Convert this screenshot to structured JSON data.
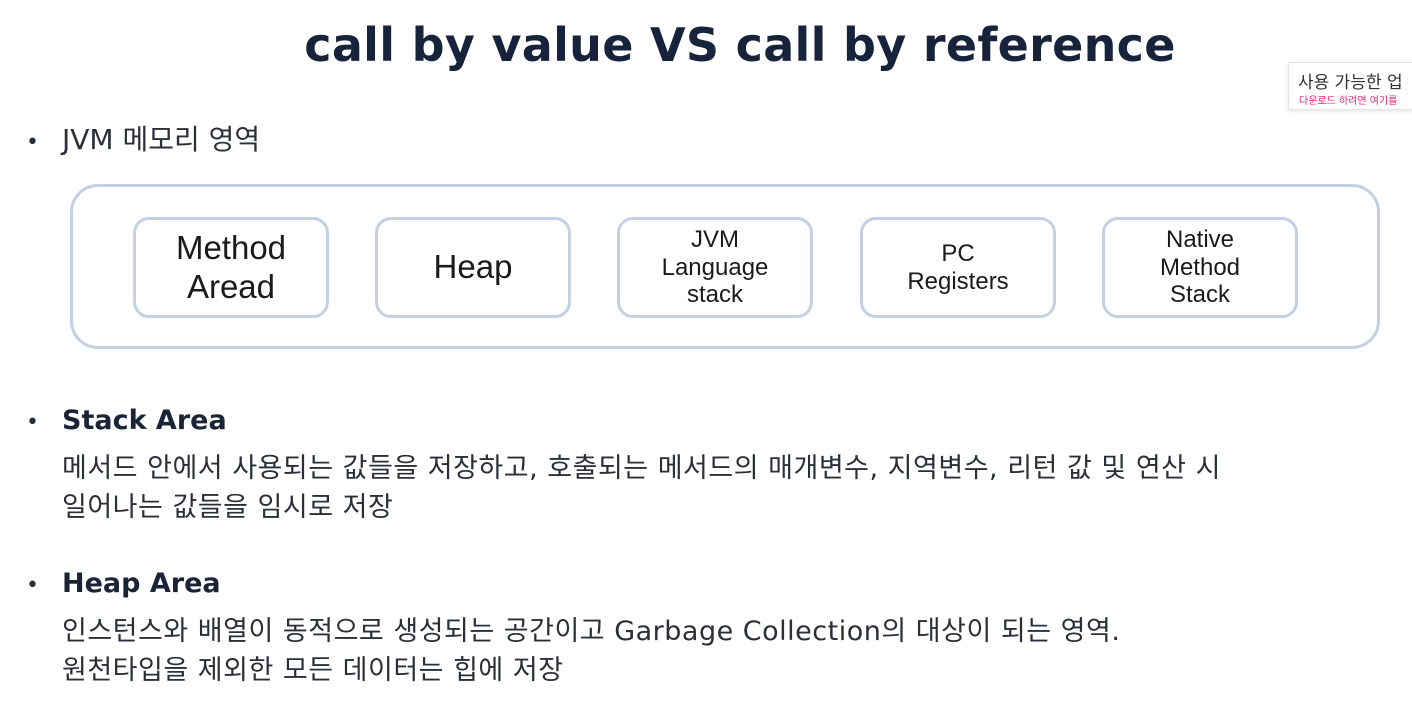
{
  "slide": {
    "title": "call by value VS call by reference",
    "bullet1": "JVM 메모리 영역",
    "areas": [
      {
        "label": "Method\nAread"
      },
      {
        "label": "Heap"
      },
      {
        "label": "JVM\nLanguage\nstack"
      },
      {
        "label": "PC\nRegisters"
      },
      {
        "label": "Native\nMethod\nStack"
      }
    ],
    "stack": {
      "heading": "Stack Area",
      "line1": "메서드 안에서 사용되는 값들을 저장하고, 호출되는 메서드의 매개변수, 지역변수, 리턴 값 및 연산 시",
      "line2": "일어나는 값들을 임시로 저장"
    },
    "heap": {
      "heading": "Heap Area",
      "line1": "인스턴스와 배열이 동적으로 생성되는 공간이고 Garbage Collection의 대상이 되는 영역.",
      "line2": "원천타입을 제외한 모든 데이터는 힙에 저장"
    },
    "bullet_glyph": "•"
  },
  "notification": {
    "title": "사용 가능한 업",
    "subtitle": "다운로드 하려면 여기를"
  }
}
